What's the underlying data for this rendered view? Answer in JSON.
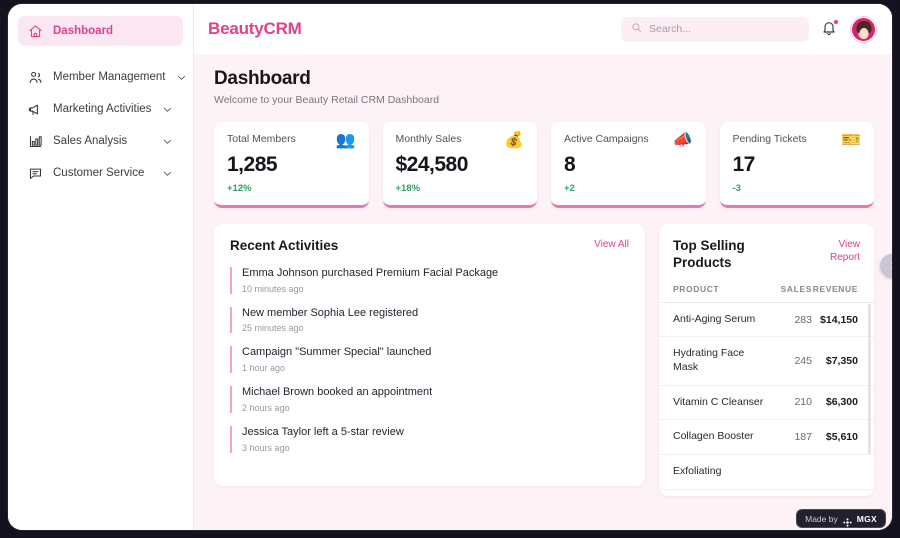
{
  "sidebar": {
    "items": [
      {
        "label": "Dashboard",
        "icon": "home-icon",
        "active": true,
        "chevron": false
      },
      {
        "label": "Member Management",
        "icon": "users-icon",
        "active": false,
        "chevron": true
      },
      {
        "label": "Marketing Activities",
        "icon": "megaphone-icon",
        "active": false,
        "chevron": true
      },
      {
        "label": "Sales Analysis",
        "icon": "bar-chart-icon",
        "active": false,
        "chevron": true
      },
      {
        "label": "Customer Service",
        "icon": "message-square-icon",
        "active": false,
        "chevron": true
      }
    ]
  },
  "topbar": {
    "brand": "BeautyCRM",
    "search_placeholder": "Search...",
    "search_value": "",
    "search_icon": "search-icon",
    "bell_icon": "bell-icon",
    "has_notification": true,
    "avatar_alt": "user-avatar"
  },
  "page": {
    "title": "Dashboard",
    "subtitle": "Welcome to your Beauty Retail CRM Dashboard"
  },
  "stats": [
    {
      "label": "Total Members",
      "value": "1,285",
      "delta": "+12%",
      "emoji": "👥",
      "icon": "people-icon",
      "accent": "#e67ab0"
    },
    {
      "label": "Monthly Sales",
      "value": "$24,580",
      "delta": "+18%",
      "emoji": "💰",
      "icon": "money-bag-icon",
      "accent": "#e67ab0"
    },
    {
      "label": "Active Campaigns",
      "value": "8",
      "delta": "+2",
      "emoji": "📣",
      "icon": "megaphone-icon",
      "accent": "#e67ab0"
    },
    {
      "label": "Pending Tickets",
      "value": "17",
      "delta": "-3",
      "emoji": "🎫",
      "icon": "ticket-icon",
      "accent": "#e67ab0"
    }
  ],
  "activities": {
    "title": "Recent Activities",
    "link": "View All",
    "items": [
      {
        "text": "Emma Johnson purchased Premium Facial Package",
        "time": "10 minutes ago"
      },
      {
        "text": "New member Sophia Lee registered",
        "time": "25 minutes ago"
      },
      {
        "text": "Campaign \"Summer Special\" launched",
        "time": "1 hour ago"
      },
      {
        "text": "Michael Brown booked an appointment",
        "time": "2 hours ago"
      },
      {
        "text": "Jessica Taylor left a 5-star review",
        "time": "3 hours ago"
      }
    ]
  },
  "products": {
    "title": "Top Selling Products",
    "link": "View Report",
    "columns": [
      "PRODUCT",
      "SALES",
      "REVENUE"
    ],
    "rows": [
      {
        "product": "Anti-Aging Serum",
        "sales": "283",
        "revenue": "$14,150"
      },
      {
        "product": "Hydrating Face Mask",
        "sales": "245",
        "revenue": "$7,350"
      },
      {
        "product": "Vitamin C Cleanser",
        "sales": "210",
        "revenue": "$6,300"
      },
      {
        "product": "Collagen Booster",
        "sales": "187",
        "revenue": "$5,610"
      },
      {
        "product": "Exfoliating",
        "sales": "",
        "revenue": ""
      }
    ]
  },
  "edge_toggle": {
    "icon": "chevron-right-icon"
  },
  "made_by": {
    "text": "Made by",
    "brand": "MGX",
    "logo_icon": "mgx-logo-icon"
  },
  "colors": {
    "accent": "#e0408c",
    "card_underline": "#e67ab0",
    "page_bg": "#fdf3f7",
    "positive": "#2f9e6b",
    "frame_bg": "#15121f"
  }
}
